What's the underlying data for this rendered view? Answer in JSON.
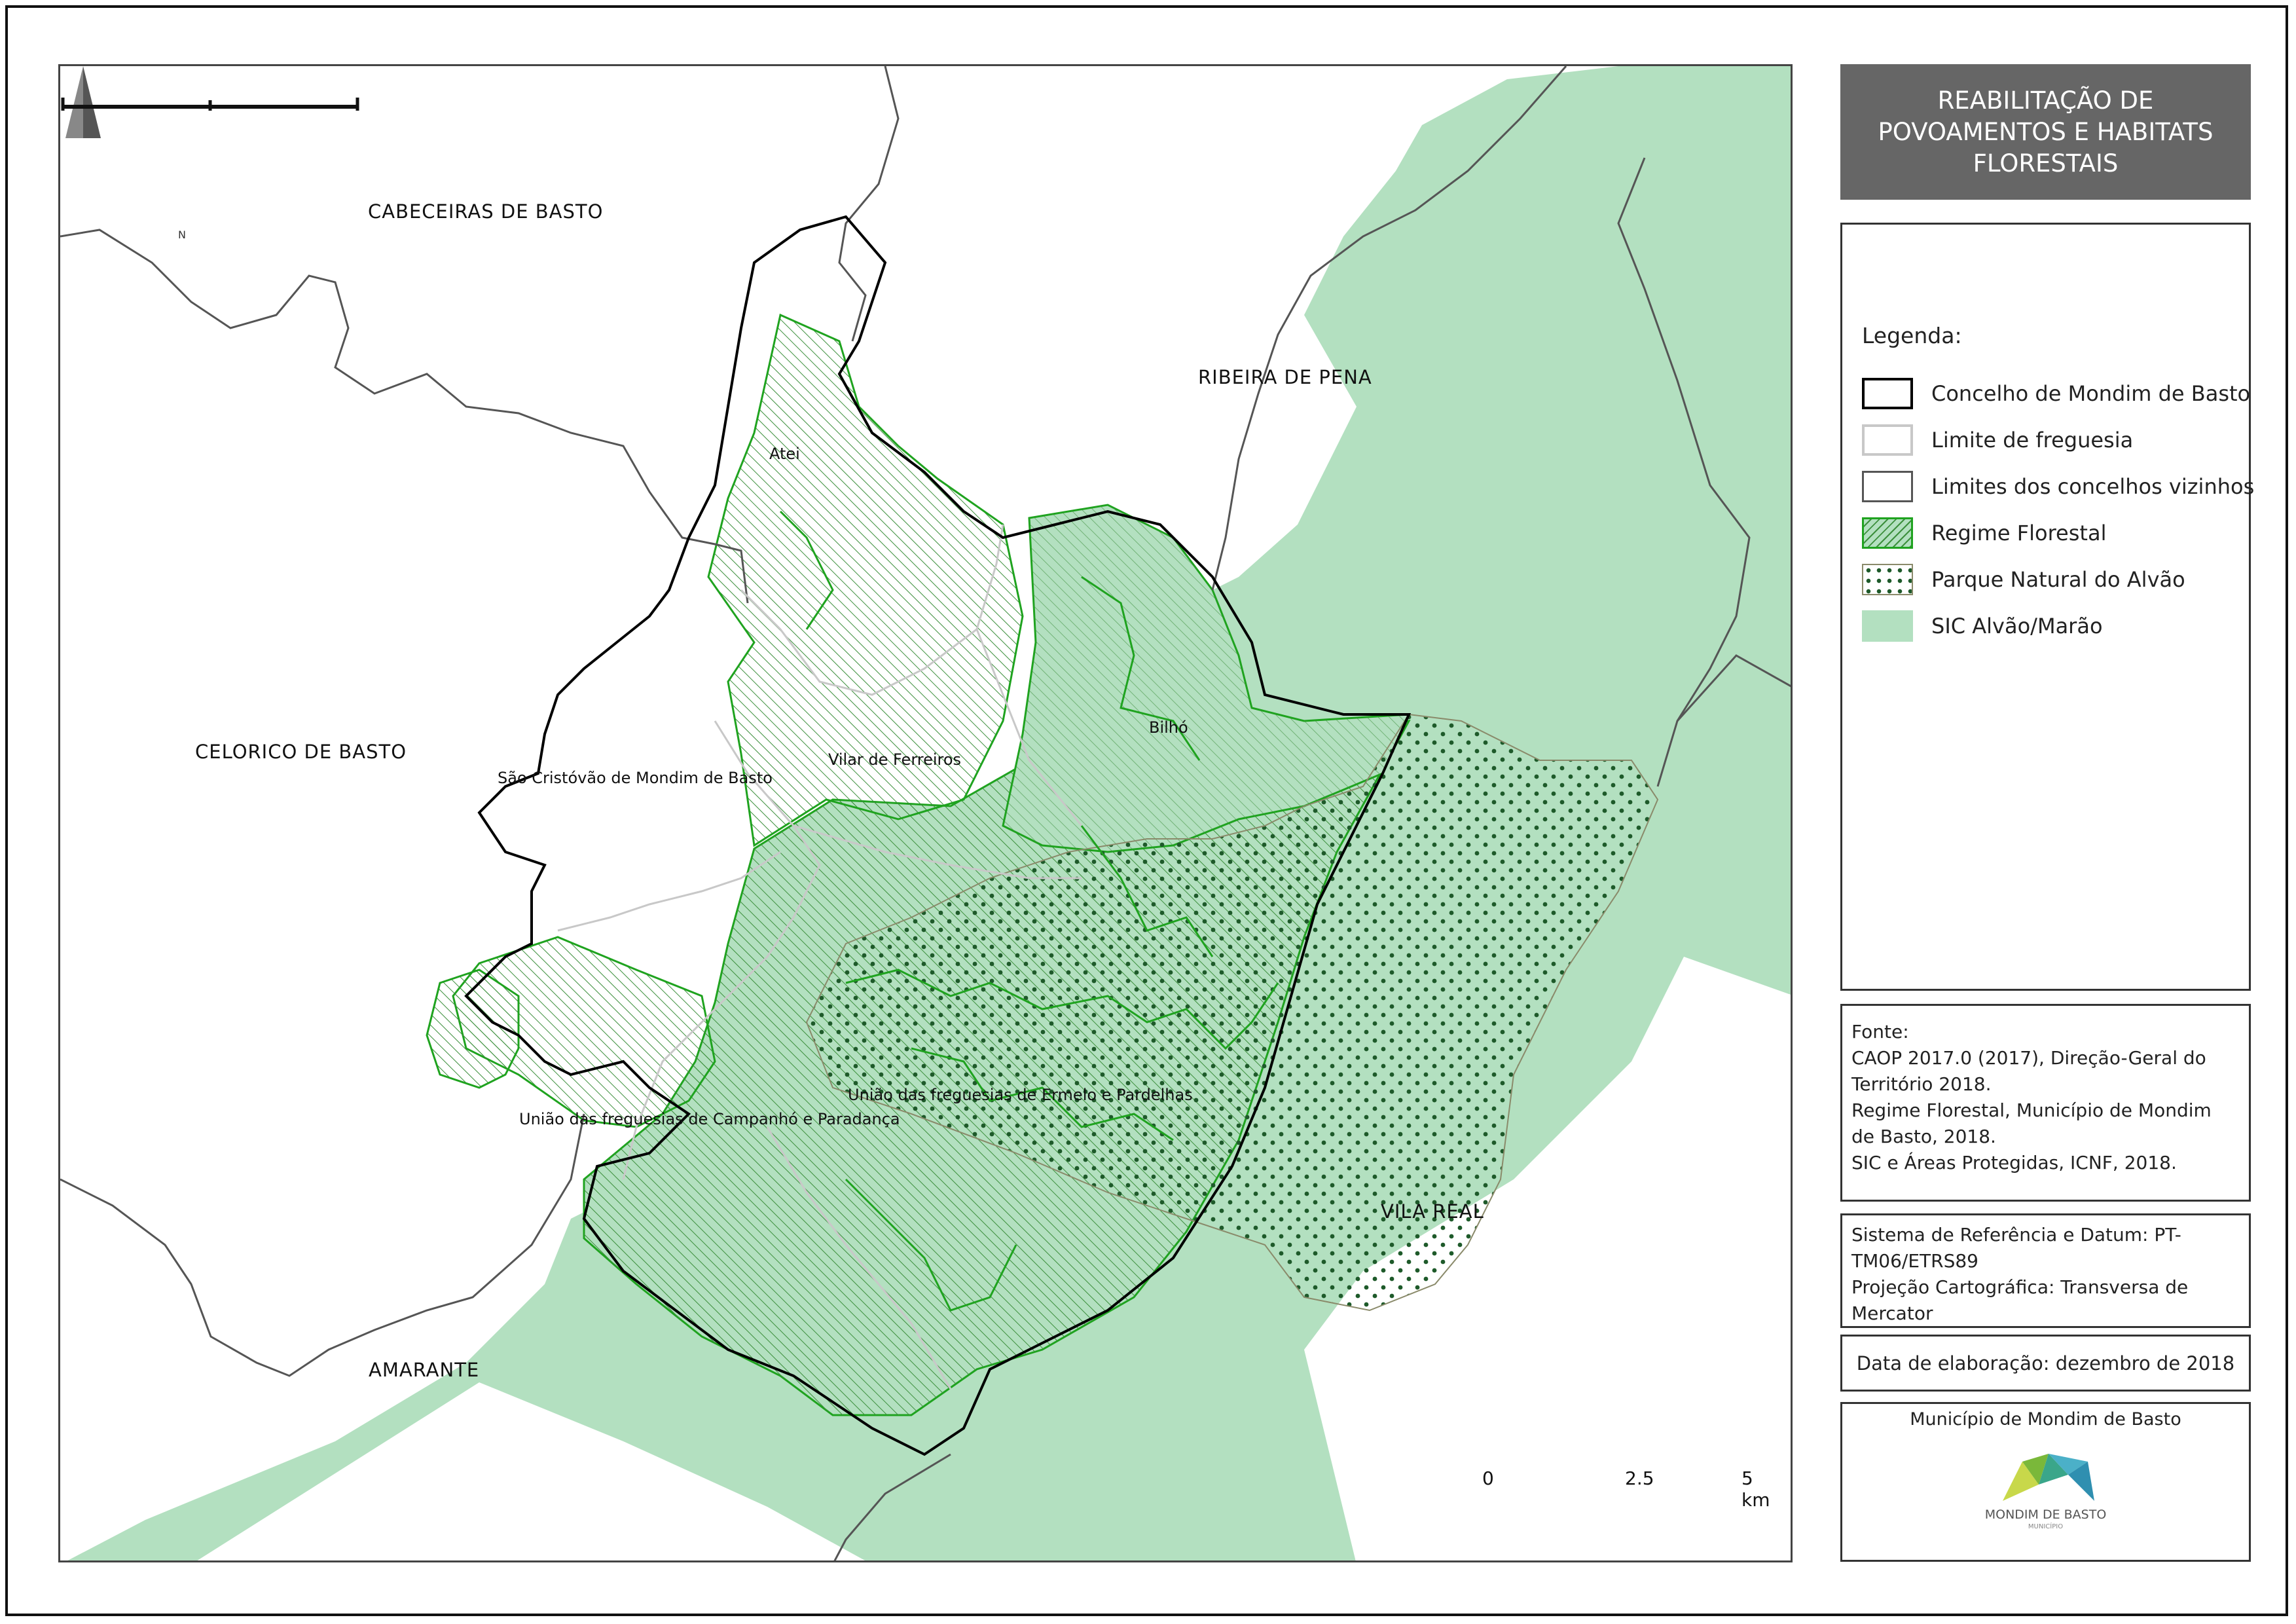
{
  "title": "REABILITAÇÃO DE POVOAMENTOS E HABITATS FLORESTAIS",
  "north_arrow": {
    "label": "N"
  },
  "map_labels": {
    "cabeceiras": "CABECEIRAS DE BASTO",
    "ribeira": "RIBEIRA DE PENA",
    "celorico": "CELORICO DE BASTO",
    "amarante": "AMARANTE",
    "vila_real": "VILA REAL",
    "atei": "Atei",
    "bilho": "Bilhó",
    "vilar": "Vilar de Ferreiros",
    "sao_cristovao": "São Cristóvão de Mondim de Basto",
    "campanho": "União das freguesias de Campanhó e Paradança",
    "ermelo": "União das freguesias de Ermelo e Pardelhas"
  },
  "scale": {
    "ticks": [
      "0",
      "2.5",
      "5 km"
    ]
  },
  "legend": {
    "heading": "Legenda:",
    "items": [
      {
        "label": "Concelho de Mondim de Basto"
      },
      {
        "label": "Limite de freguesia"
      },
      {
        "label": "Limites dos concelhos vizinhos"
      },
      {
        "label": "Regime Florestal"
      },
      {
        "label": "Parque Natural do Alvão"
      },
      {
        "label": "SIC Alvão/Marão"
      }
    ]
  },
  "colors": {
    "sic": "#b3e0c0",
    "regime": "#1fa31f",
    "parque": "#1e5a2a",
    "concelho": "#000000",
    "freguesia": "#c8c8c8",
    "vizinhos": "#555555"
  },
  "sources": {
    "heading": "Fonte:",
    "lines": [
      "CAOP 2017.0 (2017), Direção-Geral do Território 2018.",
      "Regime Florestal, Município de Mondim de Basto, 2018.",
      "SIC e Áreas Protegidas, ICNF, 2018."
    ]
  },
  "reference": {
    "lines": [
      "Sistema de Referência e Datum: PT-TM06/ETRS89",
      "Projeção Cartográfica: Transversa de Mercator"
    ]
  },
  "date": "Data de elaboração: dezembro de 2018",
  "municipality": {
    "title": "Município de Mondim de Basto",
    "logo_text": "MONDIM DE BASTO",
    "logo_sub": "MUNICÍPIO"
  }
}
